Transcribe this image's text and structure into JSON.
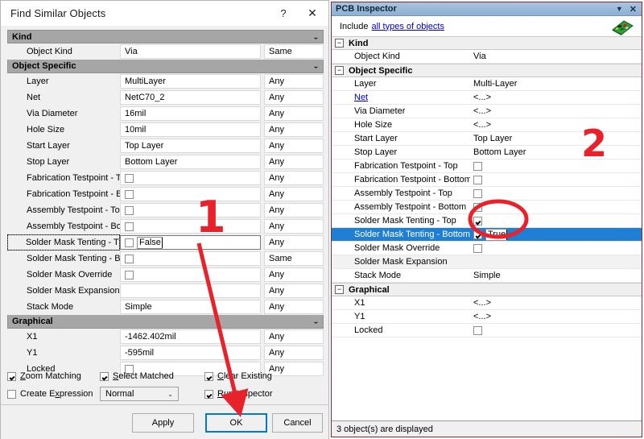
{
  "dialog": {
    "title": "Find Similar Objects",
    "help_button": "?",
    "close_button": "✕",
    "collapse_glyph": "⌄",
    "sections": [
      {
        "name": "Kind",
        "rows": [
          {
            "label": "Object Kind",
            "value": "Via",
            "op": "Same",
            "type": "text"
          }
        ]
      },
      {
        "name": "Object Specific",
        "rows": [
          {
            "label": "Layer",
            "value": "MultiLayer",
            "op": "Any",
            "type": "text"
          },
          {
            "label": "Net",
            "value": "NetC70_2",
            "op": "Any",
            "type": "text"
          },
          {
            "label": "Via Diameter",
            "value": "16mil",
            "op": "Any",
            "type": "text"
          },
          {
            "label": "Hole Size",
            "value": "10mil",
            "op": "Any",
            "type": "text"
          },
          {
            "label": "Start Layer",
            "value": "Top Layer",
            "op": "Any",
            "type": "text"
          },
          {
            "label": "Stop Layer",
            "value": "Bottom Layer",
            "op": "Any",
            "type": "text"
          },
          {
            "label": "Fabrication Testpoint - T",
            "value": "",
            "op": "Any",
            "type": "check",
            "checked": false
          },
          {
            "label": "Fabrication Testpoint - B",
            "value": "",
            "op": "Any",
            "type": "check",
            "checked": false
          },
          {
            "label": "Assembly Testpoint - Top",
            "value": "",
            "op": "Any",
            "type": "check",
            "checked": false
          },
          {
            "label": "Assembly Testpoint - Bot",
            "value": "",
            "op": "Any",
            "type": "check",
            "checked": false
          },
          {
            "label": "Solder Mask Tenting - T",
            "value": "False",
            "op": "Any",
            "type": "check-edit",
            "checked": false,
            "focused": true
          },
          {
            "label": "Solder Mask Tenting - B",
            "value": "",
            "op": "Same",
            "type": "check",
            "checked": false
          },
          {
            "label": "Solder Mask Override",
            "value": "",
            "op": "Any",
            "type": "check",
            "checked": false
          },
          {
            "label": "Solder Mask Expansion",
            "value": "",
            "op": "Any",
            "type": "text"
          },
          {
            "label": "Stack Mode",
            "value": "Simple",
            "op": "Any",
            "type": "text"
          }
        ]
      },
      {
        "name": "Graphical",
        "rows": [
          {
            "label": "X1",
            "value": "-1462.402mil",
            "op": "Any",
            "type": "text"
          },
          {
            "label": "Y1",
            "value": "-595mil",
            "op": "Any",
            "type": "text"
          },
          {
            "label": "Locked",
            "value": "",
            "op": "Any",
            "type": "check",
            "checked": false
          }
        ]
      }
    ],
    "options": {
      "zoom_matching": {
        "label": "Zoom Matching",
        "underline": "Z",
        "checked": true
      },
      "select_matched": {
        "label": "Select Matched",
        "underline": "S",
        "checked": true
      },
      "clear_existing": {
        "label": "Clear Existing",
        "underline": "C",
        "checked": true
      },
      "create_expression": {
        "label": "Create Expression",
        "underline": "x",
        "checked": false
      },
      "mode_select": {
        "value": "Normal",
        "arrow": "⌄"
      },
      "run_inspector": {
        "label": "Run Inspector",
        "underline": "R",
        "checked": true
      }
    },
    "buttons": {
      "apply": "Apply",
      "ok": "OK",
      "cancel": "Cancel"
    }
  },
  "inspector": {
    "title": "PCB Inspector",
    "dropdown_glyph": "▼",
    "close_glyph": "✕",
    "include_label": "Include",
    "include_link": "all types of objects",
    "sections": [
      {
        "name": "Kind",
        "expander": "−",
        "rows": [
          {
            "label": "Object Kind",
            "value": "Via",
            "type": "text"
          }
        ]
      },
      {
        "name": "Object Specific",
        "expander": "−",
        "rows": [
          {
            "label": "Layer",
            "value": "Multi-Layer",
            "type": "text"
          },
          {
            "label": "Net",
            "value": "<...>",
            "type": "text",
            "link": true
          },
          {
            "label": "Via Diameter",
            "value": "<...>",
            "type": "text"
          },
          {
            "label": "Hole Size",
            "value": "<...>",
            "type": "text"
          },
          {
            "label": "Start Layer",
            "value": "Top Layer",
            "type": "text"
          },
          {
            "label": "Stop Layer",
            "value": "Bottom Layer",
            "type": "text"
          },
          {
            "label": "Fabrication Testpoint - Top",
            "value": "",
            "type": "check",
            "checked": false
          },
          {
            "label": "Fabrication Testpoint - Bottom",
            "value": "",
            "type": "check",
            "checked": false
          },
          {
            "label": "Assembly Testpoint - Top",
            "value": "",
            "type": "check",
            "checked": false
          },
          {
            "label": "Assembly Testpoint - Bottom",
            "value": "",
            "type": "check",
            "checked": false
          },
          {
            "label": "Solder Mask Tenting - Top",
            "value": "",
            "type": "check",
            "checked": true
          },
          {
            "label": "Solder Mask Tenting - Bottom",
            "value": "True",
            "type": "check-edit",
            "checked": true,
            "selected": true
          },
          {
            "label": "Solder Mask Override",
            "value": "",
            "type": "check",
            "checked": false
          },
          {
            "label": "Solder Mask Expansion",
            "value": "",
            "type": "text",
            "shaded": true
          },
          {
            "label": "Stack Mode",
            "value": "Simple",
            "type": "text"
          }
        ]
      },
      {
        "name": "Graphical",
        "expander": "−",
        "rows": [
          {
            "label": "X1",
            "value": "<...>",
            "type": "text"
          },
          {
            "label": "Y1",
            "value": "<...>",
            "type": "text"
          },
          {
            "label": "Locked",
            "value": "",
            "type": "check",
            "checked": false
          }
        ]
      }
    ],
    "status": "3 object(s) are displayed"
  },
  "annotations": {
    "one": "1",
    "two": "2",
    "accent_color": "#e8222a"
  }
}
